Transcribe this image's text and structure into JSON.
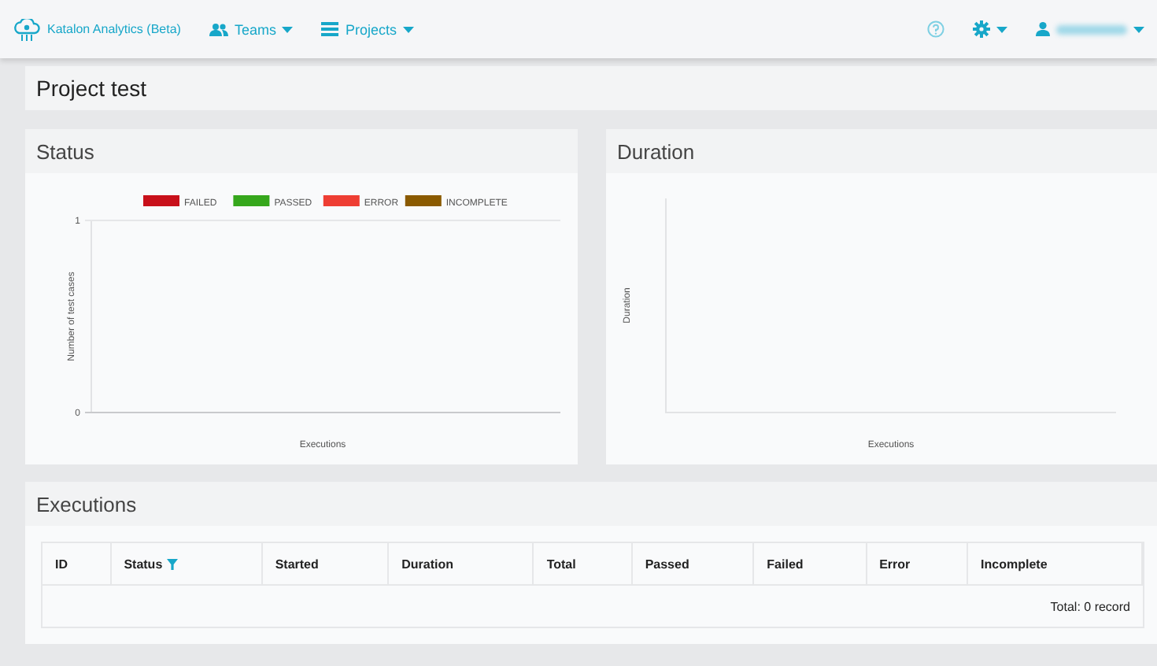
{
  "navbar": {
    "brand": "Katalon Analytics (Beta)",
    "menus": [
      {
        "kind": "teams",
        "label": "Teams"
      },
      {
        "kind": "projects",
        "label": "Projects"
      }
    ]
  },
  "page_title": "Project test",
  "status_panel": {
    "title": "Status",
    "chart_data": {
      "type": "bar",
      "xlabel": "Executions",
      "ylabel": "Number of test cases",
      "yticks": [
        0,
        1
      ],
      "ylim": [
        0,
        1
      ],
      "series": [
        {
          "name": "FAILED",
          "color": "#c8101a"
        },
        {
          "name": "PASSED",
          "color": "#36a71c"
        },
        {
          "name": "ERROR",
          "color": "#ee3e33"
        },
        {
          "name": "INCOMPLETE",
          "color": "#8a5a00"
        }
      ]
    }
  },
  "duration_panel": {
    "title": "Duration",
    "xlabel": "Executions",
    "ylabel": "Duration"
  },
  "executions": {
    "title": "Executions",
    "columns": [
      {
        "label": "ID",
        "filter": false
      },
      {
        "label": "Status",
        "filter": true
      },
      {
        "label": "Started",
        "filter": false
      },
      {
        "label": "Duration",
        "filter": false
      },
      {
        "label": "Total",
        "filter": false
      },
      {
        "label": "Passed",
        "filter": false
      },
      {
        "label": "Failed",
        "filter": false
      },
      {
        "label": "Error",
        "filter": false
      },
      {
        "label": "Incomplete",
        "filter": false
      }
    ],
    "footer": "Total: 0 record"
  }
}
